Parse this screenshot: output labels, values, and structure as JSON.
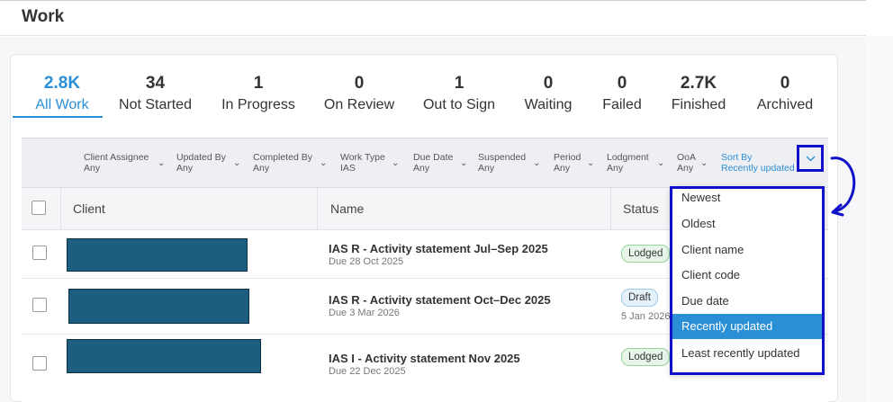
{
  "page": {
    "title": "Work"
  },
  "tabs": [
    {
      "count": "2.8K",
      "label": "All Work",
      "active": true
    },
    {
      "count": "34",
      "label": "Not Started"
    },
    {
      "count": "1",
      "label": "In Progress"
    },
    {
      "count": "0",
      "label": "On Review"
    },
    {
      "count": "1",
      "label": "Out to Sign"
    },
    {
      "count": "0",
      "label": "Waiting"
    },
    {
      "count": "0",
      "label": "Failed"
    },
    {
      "count": "2.7K",
      "label": "Finished"
    },
    {
      "count": "0",
      "label": "Archived"
    }
  ],
  "filters": [
    {
      "label": "Client Assignee",
      "value": "Any"
    },
    {
      "label": "Updated By",
      "value": "Any"
    },
    {
      "label": "Completed By",
      "value": "Any"
    },
    {
      "label": "Work Type",
      "value": "IAS"
    },
    {
      "label": "Due Date",
      "value": "Any"
    },
    {
      "label": "Suspended",
      "value": "Any"
    },
    {
      "label": "Period",
      "value": "Any"
    },
    {
      "label": "Lodgment",
      "value": "Any"
    },
    {
      "label": "OoA",
      "value": "Any"
    },
    {
      "label": "Sort By",
      "value": "Recently updated"
    }
  ],
  "table": {
    "columns": [
      "Client",
      "Name",
      "Status"
    ],
    "rows": [
      {
        "name": "IAS R - Activity statement Jul–Sep 2025",
        "due": "Due 28 Oct 2025",
        "status": "Lodged",
        "status_date": ""
      },
      {
        "name": "IAS R - Activity statement Oct–Dec 2025",
        "due": "Due 3 Mar 2026",
        "status": "Draft",
        "status_date": "5 Jan 2026"
      },
      {
        "name": "IAS I - Activity statement Nov 2025",
        "due": "Due 22 Dec 2025",
        "status": "Lodged",
        "status_date": ""
      }
    ]
  },
  "sort_menu": {
    "options": [
      "Newest",
      "Oldest",
      "Client name",
      "Client code",
      "Due date",
      "Recently updated",
      "Least recently updated"
    ],
    "selected": "Recently updated"
  },
  "colors": {
    "accent": "#2b8fd6",
    "highlight_box": "#1010c8",
    "redaction": "#1c5d80"
  }
}
